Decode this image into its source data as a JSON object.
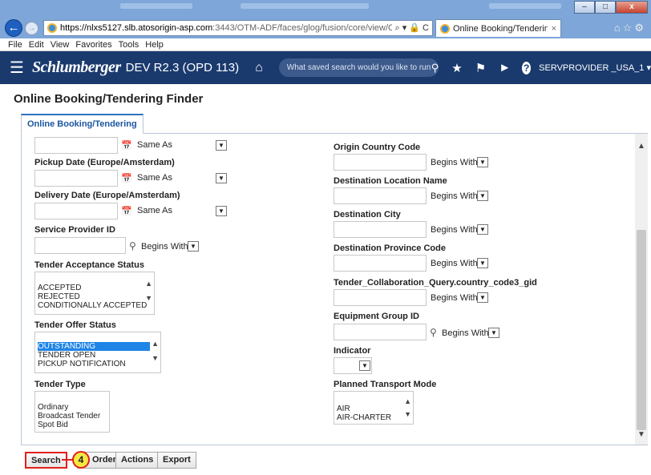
{
  "browser": {
    "url_host": "https://nlxs5127.slb.atosorigin-asp.com",
    "url_path": ":3443/OTM-ADF/faces/glog/fusion/core/view/OTMHc",
    "address_tools": "⌕ ▾ 🔒 C",
    "tab_title": "Online Booking/Tendering ...",
    "tab_close": "×",
    "win_minimize": "–",
    "win_maximize": "□",
    "win_close": "x",
    "menu": [
      "File",
      "Edit",
      "View",
      "Favorites",
      "Tools",
      "Help"
    ]
  },
  "header": {
    "brand": "Schlumberger",
    "env": "DEV R2.3 (OPD 113)",
    "search_placeholder": "What saved search would you like to run?",
    "user": "SERVPROVIDER _USA_1 ▾"
  },
  "page": {
    "title": "Online Booking/Tendering Finder",
    "tab": "Online Booking/Tendering"
  },
  "left": {
    "top_date_operator": "Same As",
    "pickup_label": "Pickup Date (Europe/Amsterdam)",
    "pickup_operator": "Same As",
    "delivery_label": "Delivery Date (Europe/Amsterdam)",
    "delivery_operator": "Same As",
    "service_provider_label": "Service Provider ID",
    "service_provider_operator": "Begins With",
    "acceptance_label": "Tender Acceptance Status",
    "acceptance_options": [
      "ACCEPTED",
      "REJECTED",
      "CONDITIONALLY ACCEPTED"
    ],
    "offer_label": "Tender Offer Status",
    "offer_options": [
      "OUTSTANDING",
      "TENDER OPEN",
      "PICKUP NOTIFICATION"
    ],
    "tender_type_label": "Tender Type",
    "tender_type_options": [
      "Ordinary",
      "Broadcast Tender",
      "Spot Bid"
    ]
  },
  "right": {
    "origin_country_label": "Origin Country Code",
    "origin_country_operator": "Begins With",
    "dest_location_label": "Destination Location Name",
    "dest_location_operator": "Begins With",
    "dest_city_label": "Destination City",
    "dest_city_operator": "Begins With",
    "dest_province_label": "Destination Province Code",
    "dest_province_operator": "Begins With",
    "country_code3_label": "Tender_Collaboration_Query.country_code3_gid",
    "country_code3_operator": "Begins With",
    "equipment_label": "Equipment Group ID",
    "equipment_operator": "Begins With",
    "indicator_label": "Indicator",
    "transport_mode_label": "Planned Transport Mode",
    "transport_mode_options": [
      "AIR",
      "AIR-CHARTER"
    ]
  },
  "footer": {
    "search": "Search",
    "order": "Order",
    "actions": "Actions",
    "export": "Export",
    "callout": "4"
  },
  "colors": {
    "header_bg": "#1a3a6e",
    "selected_option": "#1e84e6",
    "highlight": "#e0201b",
    "callout_fill": "#f7e842"
  }
}
